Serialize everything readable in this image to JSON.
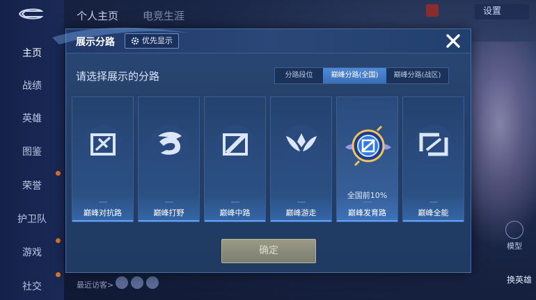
{
  "background": {
    "top_nav": [
      "个人主页",
      "电竞生涯"
    ],
    "sidebar_items": [
      "主页",
      "战绩",
      "英雄",
      "图鉴",
      "荣誉",
      "护卫队",
      "游戏",
      "社交"
    ],
    "settings_label": "设置",
    "model_label": "模型",
    "swap_hero_label": "换英雄",
    "recent_visitors_label": "最近访客>"
  },
  "modal": {
    "title": "展示分路",
    "priority_label": "优先显示",
    "subtitle": "请选择展示的分路",
    "tabs": [
      {
        "label": "分路段位",
        "active": false
      },
      {
        "label": "巅峰分路(全国)",
        "active": true
      },
      {
        "label": "巅峰分路(战区)",
        "active": false
      }
    ],
    "cards": [
      {
        "label": "巅峰对抗路",
        "icon": "clash-lane-icon",
        "rank": ""
      },
      {
        "label": "巅峰打野",
        "icon": "jungle-icon",
        "rank": ""
      },
      {
        "label": "巅峰中路",
        "icon": "mid-lane-icon",
        "rank": ""
      },
      {
        "label": "巅峰游走",
        "icon": "roam-icon",
        "rank": ""
      },
      {
        "label": "巅峰发育路",
        "icon": "farm-lane-badge-icon",
        "rank": "全国前10%"
      },
      {
        "label": "巅峰全能",
        "icon": "all-round-icon",
        "rank": ""
      }
    ],
    "confirm_label": "确定"
  },
  "colors": {
    "accent": "#3a6fb8",
    "modal_bg": "#244068",
    "confirm_bg": "#8a8b78"
  }
}
